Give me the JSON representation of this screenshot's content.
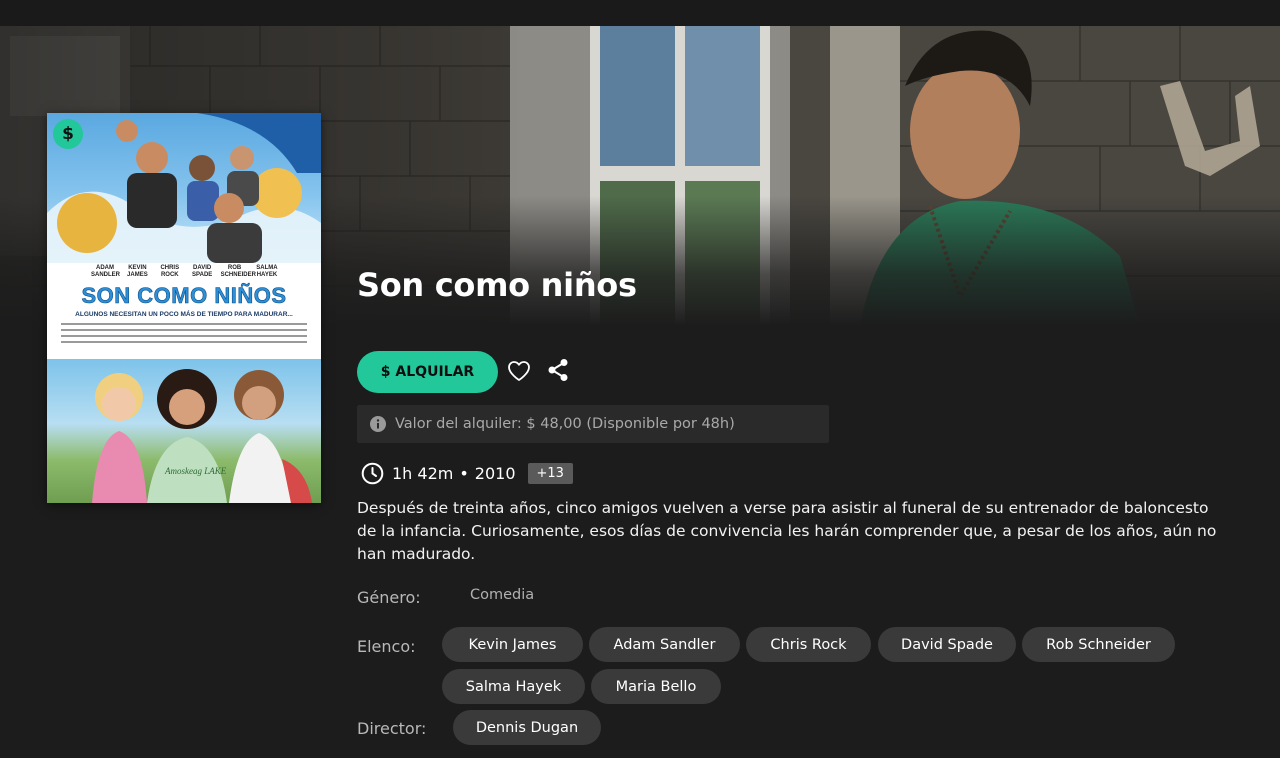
{
  "movie": {
    "title": "Son como niños",
    "duration": "1h 42m",
    "separator": "•",
    "year": "2010",
    "age_rating": "+13",
    "synopsis": "Después de treinta años, cinco amigos vuelven a verse para asistir al funeral de su entrenador de baloncesto de la infancia. Curiosamente, esos días de convivencia les harán comprender que, a pesar de los años, aún no han madurado."
  },
  "poster": {
    "badge_symbol": "$",
    "title_text": "SON COMO NIÑOS",
    "tagline": "ALGUNOS NECESITAN UN POCO MÁS DE TIEMPO PARA MADURAR...",
    "names": [
      "ADAM SANDLER",
      "KEVIN JAMES",
      "CHRIS ROCK",
      "DAVID SPADE",
      "ROB SCHNEIDER",
      "SALMA HAYEK"
    ],
    "shirt_text": "Amoskeag LAKE"
  },
  "actions": {
    "rent_label": "$ ALQUILAR",
    "favorite_icon": "heart-outline-icon",
    "share_icon": "share-icon"
  },
  "rent_info": {
    "icon": "info-icon",
    "text": "Valor del alquiler: $ 48,00 (Disponible por 48h)"
  },
  "details": {
    "genre_label": "Género:",
    "genre_value": "Comedia",
    "cast_label": "Elenco:",
    "cast": [
      "Kevin James",
      "Adam Sandler",
      "Chris Rock",
      "David Spade",
      "Rob Schneider",
      "Salma Hayek",
      "Maria Bello"
    ],
    "director_label": "Director:",
    "director": [
      "Dennis Dugan"
    ]
  },
  "colors": {
    "accent": "#22c79a",
    "background": "#1c1c1c",
    "chip": "#3a3a3a",
    "info_box": "#2a2a2a"
  }
}
